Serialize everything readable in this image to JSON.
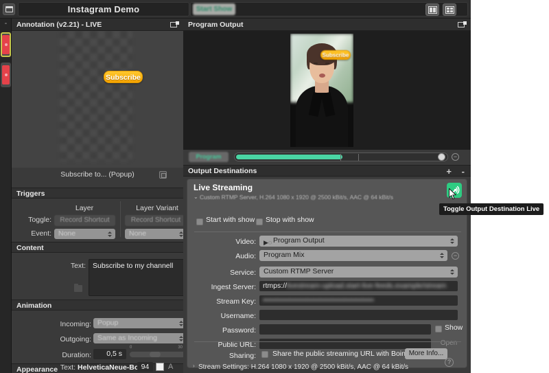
{
  "window": {
    "title": "Instagram Demo",
    "start_show_label": "Start Show",
    "menu_icon": "film-strip-icon",
    "layout_icon_1": "layout-split-icon",
    "layout_icon_2": "layout-grid-icon"
  },
  "left_rail": {
    "collapse_label": "-",
    "layers": [
      {
        "name": "layer-thumb-selected"
      },
      {
        "name": "layer-thumb"
      }
    ]
  },
  "left_panel": {
    "header": "Annotation (v2.21) - LIVE",
    "pin_icon": "detach-window-icon",
    "canvas": {
      "overlay_label": "Subscribe",
      "caption": "Subscribe to... (Popup)",
      "caption_icon": "duplicate-icon"
    },
    "triggers": {
      "section_label": "Triggers",
      "columns": [
        "Layer",
        "Layer Variant"
      ],
      "toggle_label": "Toggle:",
      "event_label": "Event:",
      "record_shortcut_layer": "Record Shortcut",
      "record_shortcut_variant": "Record Shortcut",
      "event_layer": "None",
      "event_variant": "None"
    },
    "content": {
      "section_label": "Content",
      "text_label": "Text:",
      "text_value": "Subscribe to my channell",
      "folder_icon": "folder-icon"
    },
    "animation": {
      "section_label": "Animation",
      "incoming_label": "Incoming:",
      "incoming_value": "Popup",
      "outgoing_label": "Outgoing:",
      "outgoing_value": "Same as Incoming",
      "duration_label": "Duration:",
      "duration_value": "0,5 s",
      "slider_min": "0",
      "slider_max": "30"
    },
    "appearance": {
      "section_label": "Appearance",
      "text_label": "Text:",
      "font_name": "HelveticaNeue-Bold",
      "font_size": "94",
      "color_swatch": "#f2f2f2",
      "aa_icon": "A"
    }
  },
  "right_panel": {
    "header": "Program Output",
    "pin_icon": "detach-window-icon",
    "preview_overlay_label": "Subscribe",
    "program_chip_label": "Program",
    "meter_minus_icon": "minus-circle-icon",
    "output_destinations": {
      "header": "Output Destinations",
      "add_icon": "+",
      "remove_icon": "-",
      "destination": {
        "title": "Live Streaming",
        "subtitle": "Custom RTMP Server, H.264 1080 x 1920 @ 2500 kBit/s, AAC @ 64 kBit/s",
        "disclosure_icon": "chevron-down-icon",
        "live_toggle_icon": "broadcast-icon",
        "live_toggle_color": "#2ecc82",
        "start_with_show": "Start with show",
        "stop_with_show": "Stop with show",
        "video_label": "Video:",
        "video_value": "Program Output",
        "video_source_icon": "video-source-icon",
        "audio_label": "Audio:",
        "audio_value": "Program Mix",
        "audio_remove_icon": "minus-circle-icon",
        "service_label": "Service:",
        "service_value": "Custom RTMP Server",
        "ingest_label": "Ingest Server:",
        "ingest_prefix": "rtmps://",
        "ingest_value": "livestream-upload.start-live-feeds.example/stream",
        "stream_key_label": "Stream Key:",
        "stream_key_value": "••••••••••••••••••••••••••••••••••••••••••••",
        "username_label": "Username:",
        "username_value": "",
        "password_label": "Password:",
        "password_value": "",
        "show_password_label": "Show",
        "public_url_label": "Public URL:",
        "public_url_value": "",
        "open_button_label": "Open",
        "sharing_label": "Sharing:",
        "sharing_checkbox_label": "Share the public streaming URL with Boinx Software",
        "more_info_label": "More Info...",
        "stream_settings": "Stream Settings: H.264 1080 x 1920 @ 2500 kBit/s, AAC @ 64 kBit/s",
        "stream_settings_arrow": "chevron-right-icon"
      }
    },
    "help_icon": "?"
  },
  "tooltip": {
    "text": "Toggle Output Destination Live"
  }
}
